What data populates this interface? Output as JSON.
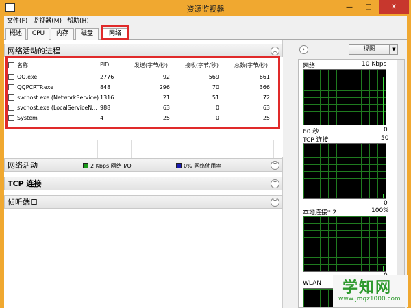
{
  "window": {
    "title": "资源监视器",
    "minimize": "—",
    "maximize": "□",
    "close": "✕"
  },
  "menu": {
    "file": "文件(F)",
    "monitor": "监视器(M)",
    "help": "帮助(H)"
  },
  "tabs": {
    "overview": "概述",
    "cpu": "CPU",
    "memory": "内存",
    "disk": "磁盘",
    "network": "网络",
    "active": "network"
  },
  "processes": {
    "title": "网络活动的进程",
    "columns": {
      "name": "名称",
      "pid": "PID",
      "send": "发送(字节/秒)",
      "receive": "接收(字节/秒)",
      "total": "总数(字节/秒)"
    },
    "rows": [
      {
        "name": "QQ.exe",
        "pid": "2776",
        "send": "92",
        "receive": "569",
        "total": "661"
      },
      {
        "name": "QQPCRTP.exe",
        "pid": "848",
        "send": "296",
        "receive": "70",
        "total": "366"
      },
      {
        "name": "svchost.exe (NetworkService)",
        "pid": "1316",
        "send": "21",
        "receive": "51",
        "total": "72"
      },
      {
        "name": "svchost.exe (LocalServiceN...",
        "pid": "988",
        "send": "63",
        "receive": "0",
        "total": "63"
      },
      {
        "name": "System",
        "pid": "4",
        "send": "25",
        "receive": "0",
        "total": "25"
      }
    ]
  },
  "network_activity": {
    "title": "网络活动",
    "io": "2 Kbps 网络 I/O",
    "usage": "0% 网络使用率"
  },
  "tcp": {
    "title": "TCP 连接"
  },
  "listen": {
    "title": "侦听端口"
  },
  "right": {
    "view_label": "视图",
    "graphs": [
      {
        "label": "网络",
        "value": "10 Kbps",
        "footer_left": "60 秒",
        "footer_right": "0"
      },
      {
        "label": "TCP 连接",
        "value": "50",
        "footer_left": "",
        "footer_right": "0"
      },
      {
        "label": "本地连接* 2",
        "value": "100%",
        "footer_left": "",
        "footer_right": "0"
      },
      {
        "label": "WLAN",
        "value": "",
        "footer_left": "",
        "footer_right": ""
      }
    ]
  },
  "watermark": {
    "title": "学知网",
    "url": "www.jmqz1000.com"
  },
  "colors": {
    "highlight": "#e02a2a",
    "io_badge": "#1a9a1a",
    "usage_badge": "#1a1ab0"
  }
}
